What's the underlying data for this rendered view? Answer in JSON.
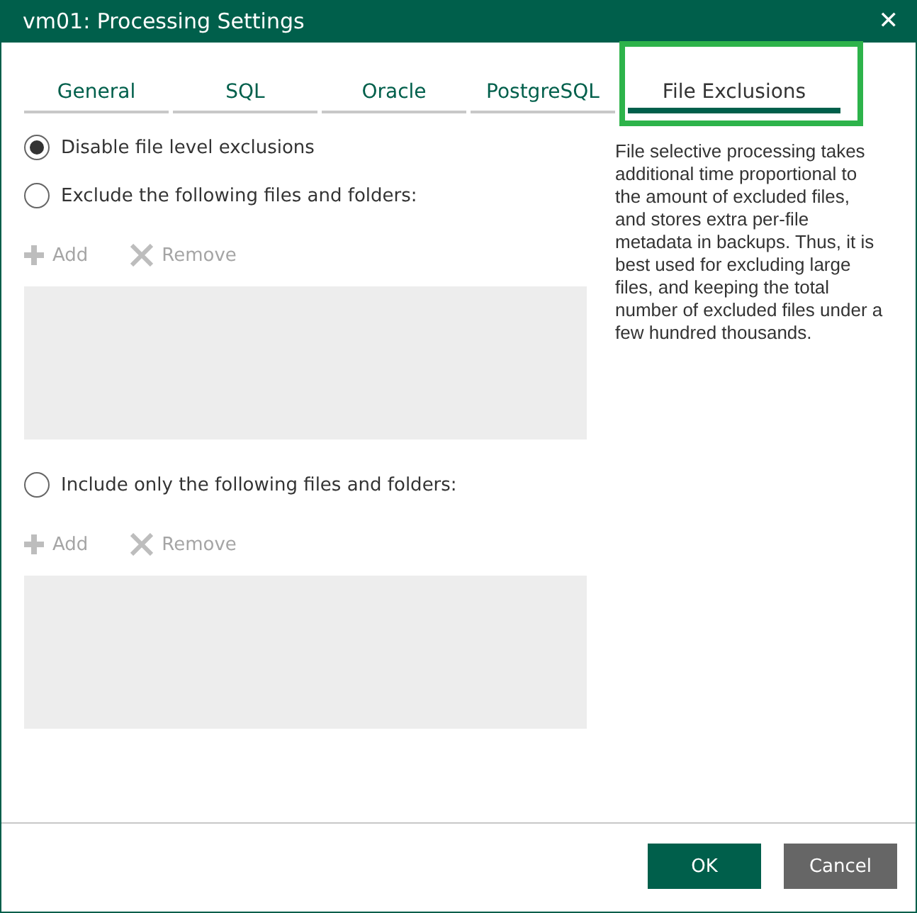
{
  "window": {
    "title": "vm01: Processing Settings",
    "close": "✕"
  },
  "tabs": [
    {
      "label": "General",
      "selected": false,
      "highlighted": false
    },
    {
      "label": "SQL",
      "selected": false,
      "highlighted": false
    },
    {
      "label": "Oracle",
      "selected": false,
      "highlighted": false
    },
    {
      "label": "PostgreSQL",
      "selected": false,
      "highlighted": false
    },
    {
      "label": "File Exclusions",
      "selected": true,
      "highlighted": true
    }
  ],
  "options": [
    {
      "kind": "plain",
      "label": "Disable file level exclusions",
      "selected": true
    },
    {
      "kind": "list",
      "label": "Exclude the following files and folders:",
      "selected": false,
      "actions": [
        {
          "label": "Add",
          "disabled": true
        },
        {
          "label": "Remove",
          "disabled": true
        }
      ]
    },
    {
      "kind": "list",
      "label": "Include only the following files and folders:",
      "selected": false,
      "actions": [
        {
          "label": "Add",
          "disabled": true
        },
        {
          "label": "Remove",
          "disabled": true
        }
      ]
    }
  ],
  "help_text": "File selective processing takes additional time proportional to the amount of excluded files, and stores extra per-file metadata in backups. Thus, it is best used for excluding large files, and keeping the total number of excluded files under a few hundred thousands.",
  "buttons": [
    {
      "label": "OK",
      "kind": "primary"
    },
    {
      "label": "Cancel",
      "kind": "secondary"
    }
  ]
}
